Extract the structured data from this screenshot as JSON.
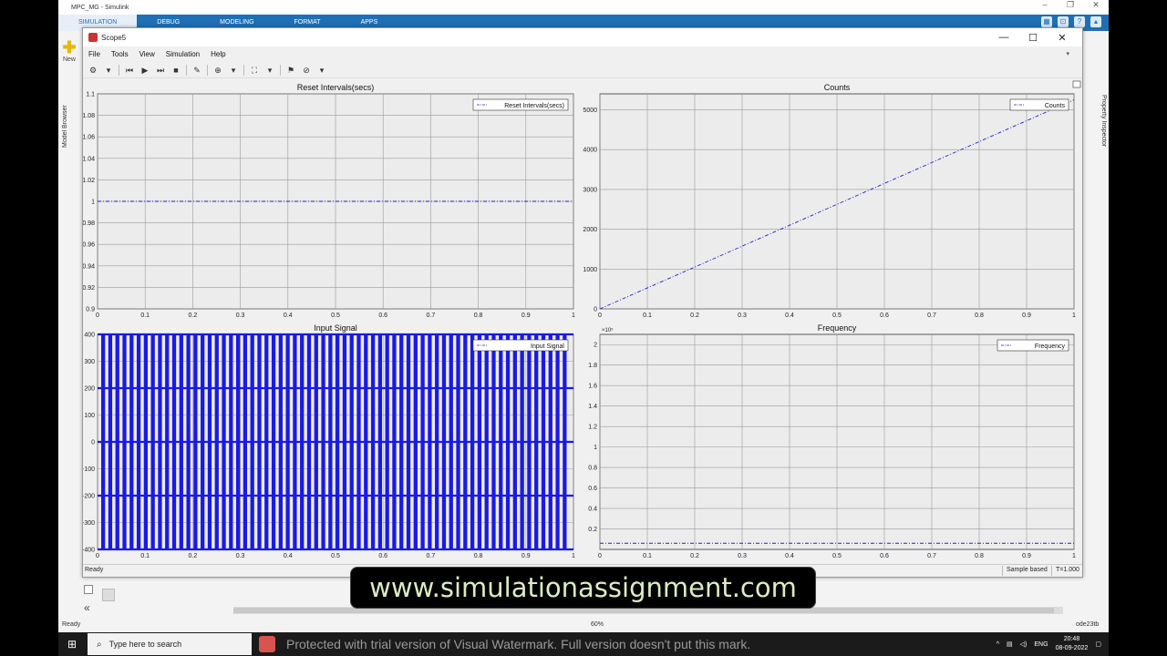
{
  "app": {
    "window_title": "MPC_MG - Simulink",
    "tabs": [
      "SIMULATION",
      "DEBUG",
      "MODELING",
      "FORMAT",
      "APPS"
    ],
    "active_tab": "SIMULATION",
    "new_label": "New",
    "left_panel_label": "Model Browser",
    "right_panel_label": "Property Inspector",
    "status": "Ready",
    "zoom": "60%",
    "solver": "ode23tb"
  },
  "scope": {
    "title": "Scope5",
    "menu": [
      "File",
      "Tools",
      "View",
      "Simulation",
      "Help"
    ],
    "status_left": "Ready",
    "status_mode": "Sample based",
    "status_time": "T=1.000"
  },
  "chart_data": [
    {
      "type": "line",
      "title": "Reset Intervals(secs)",
      "legend": [
        "Reset Intervals(secs)"
      ],
      "legend_placement": "top-right",
      "x": [
        0,
        1
      ],
      "series": [
        {
          "name": "Reset Intervals(secs)",
          "values": [
            1,
            1
          ],
          "style": "step"
        }
      ],
      "xlim": [
        0,
        1
      ],
      "ylim": [
        0.9,
        1.1
      ],
      "xticks": [
        "0",
        "0.1",
        "0.2",
        "0.3",
        "0.4",
        "0.5",
        "0.6",
        "0.7",
        "0.8",
        "0.9",
        "1"
      ],
      "yticks": [
        "0.9",
        "0.92",
        "0.94",
        "0.96",
        "0.98",
        "1",
        "1.02",
        "1.04",
        "1.06",
        "1.08",
        "1.1"
      ],
      "grid": true
    },
    {
      "type": "line",
      "title": "Counts",
      "legend": [
        "Counts"
      ],
      "legend_placement": "top-right",
      "x": [
        0,
        0.2,
        0.4,
        0.6,
        0.8,
        1
      ],
      "series": [
        {
          "name": "Counts",
          "values": [
            0,
            1050,
            2100,
            3150,
            4200,
            5250
          ],
          "style": "step"
        }
      ],
      "xlim": [
        0,
        1
      ],
      "ylim": [
        0,
        5400
      ],
      "xticks": [
        "0",
        "0.1",
        "0.2",
        "0.3",
        "0.4",
        "0.5",
        "0.6",
        "0.7",
        "0.8",
        "0.9",
        "1"
      ],
      "yticks": [
        "0",
        "1000",
        "2000",
        "3000",
        "4000",
        "5000"
      ],
      "grid": true
    },
    {
      "type": "line",
      "title": "Input Signal",
      "legend": [
        "Input Signal"
      ],
      "legend_placement": "top-right",
      "series": [
        {
          "name": "Input Signal",
          "values": [
            -400,
            -200,
            0,
            200,
            400
          ],
          "style": "step"
        }
      ],
      "levels": [
        -400,
        -200,
        0,
        200,
        400
      ],
      "pulses": 66,
      "xlim": [
        0,
        1
      ],
      "ylim": [
        -400,
        400
      ],
      "xticks": [
        "0",
        "0.1",
        "0.2",
        "0.3",
        "0.4",
        "0.5",
        "0.6",
        "0.7",
        "0.8",
        "0.9",
        "1"
      ],
      "yticks": [
        "-400",
        "-300",
        "-200",
        "-100",
        "0",
        "100",
        "200",
        "300",
        "400"
      ],
      "grid": true
    },
    {
      "type": "line",
      "title": "Frequency",
      "legend": [
        "Frequency"
      ],
      "legend_placement": "top-right",
      "exponent_label": "×10⁵",
      "x": [
        0,
        1
      ],
      "series": [
        {
          "name": "Frequency",
          "values": [
            0.06,
            0.06
          ],
          "style": "dashdot"
        }
      ],
      "xlim": [
        0,
        1
      ],
      "ylim": [
        0,
        2.1
      ],
      "xticks": [
        "0",
        "0.1",
        "0.2",
        "0.3",
        "0.4",
        "0.5",
        "0.6",
        "0.7",
        "0.8",
        "0.9",
        "1"
      ],
      "yticks": [
        "0.2",
        "0.4",
        "0.6",
        "0.8",
        "1",
        "1.2",
        "1.4",
        "1.6",
        "1.8",
        "2"
      ],
      "grid": true
    }
  ],
  "overlay": {
    "banner": "www.simulationassignment.com",
    "watermark": "Protected with trial version of Visual Watermark. Full version doesn't put this mark."
  },
  "taskbar": {
    "search_placeholder": "Type here to search",
    "lang": "ENG",
    "time": "20:48",
    "date": "08-09-2022"
  }
}
